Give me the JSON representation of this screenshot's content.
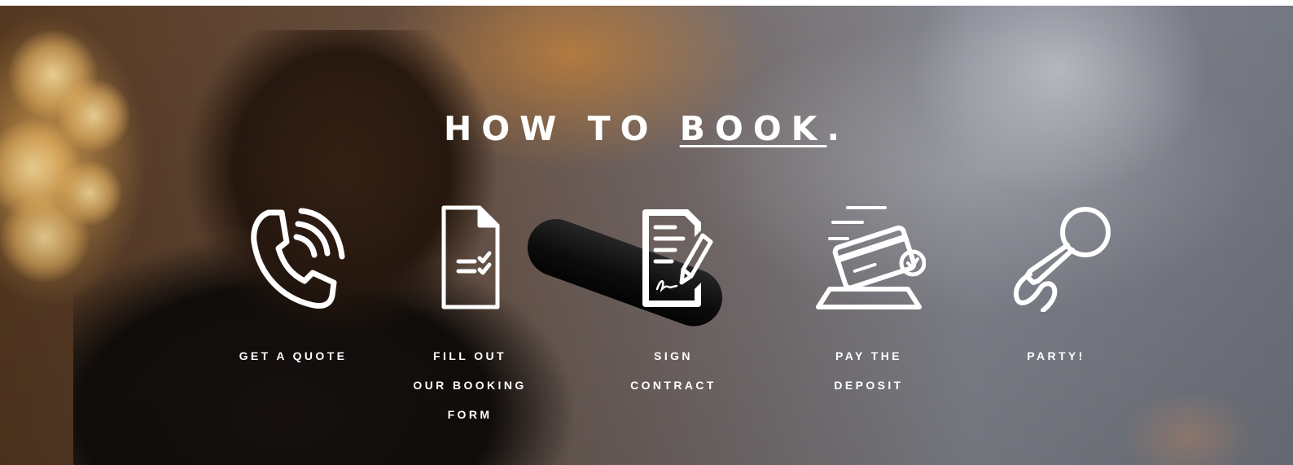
{
  "heading": {
    "prefix": "HOW TO ",
    "highlight": "BOOK",
    "suffix": "."
  },
  "steps": [
    {
      "icon": "phone-call-icon",
      "lines": [
        "GET A QUOTE"
      ]
    },
    {
      "icon": "checklist-document-icon",
      "lines": [
        "FILL OUT",
        "OUR BOOKING",
        "FORM"
      ]
    },
    {
      "icon": "signed-contract-icon",
      "lines": [
        "SIGN",
        "CONTRACT"
      ]
    },
    {
      "icon": "card-payment-icon",
      "lines": [
        "PAY THE",
        "DEPOSIT"
      ]
    },
    {
      "icon": "microphone-icon",
      "lines": [
        "PARTY!"
      ]
    }
  ],
  "colors": {
    "text": "#ffffff",
    "background_page": "#ffffff"
  }
}
